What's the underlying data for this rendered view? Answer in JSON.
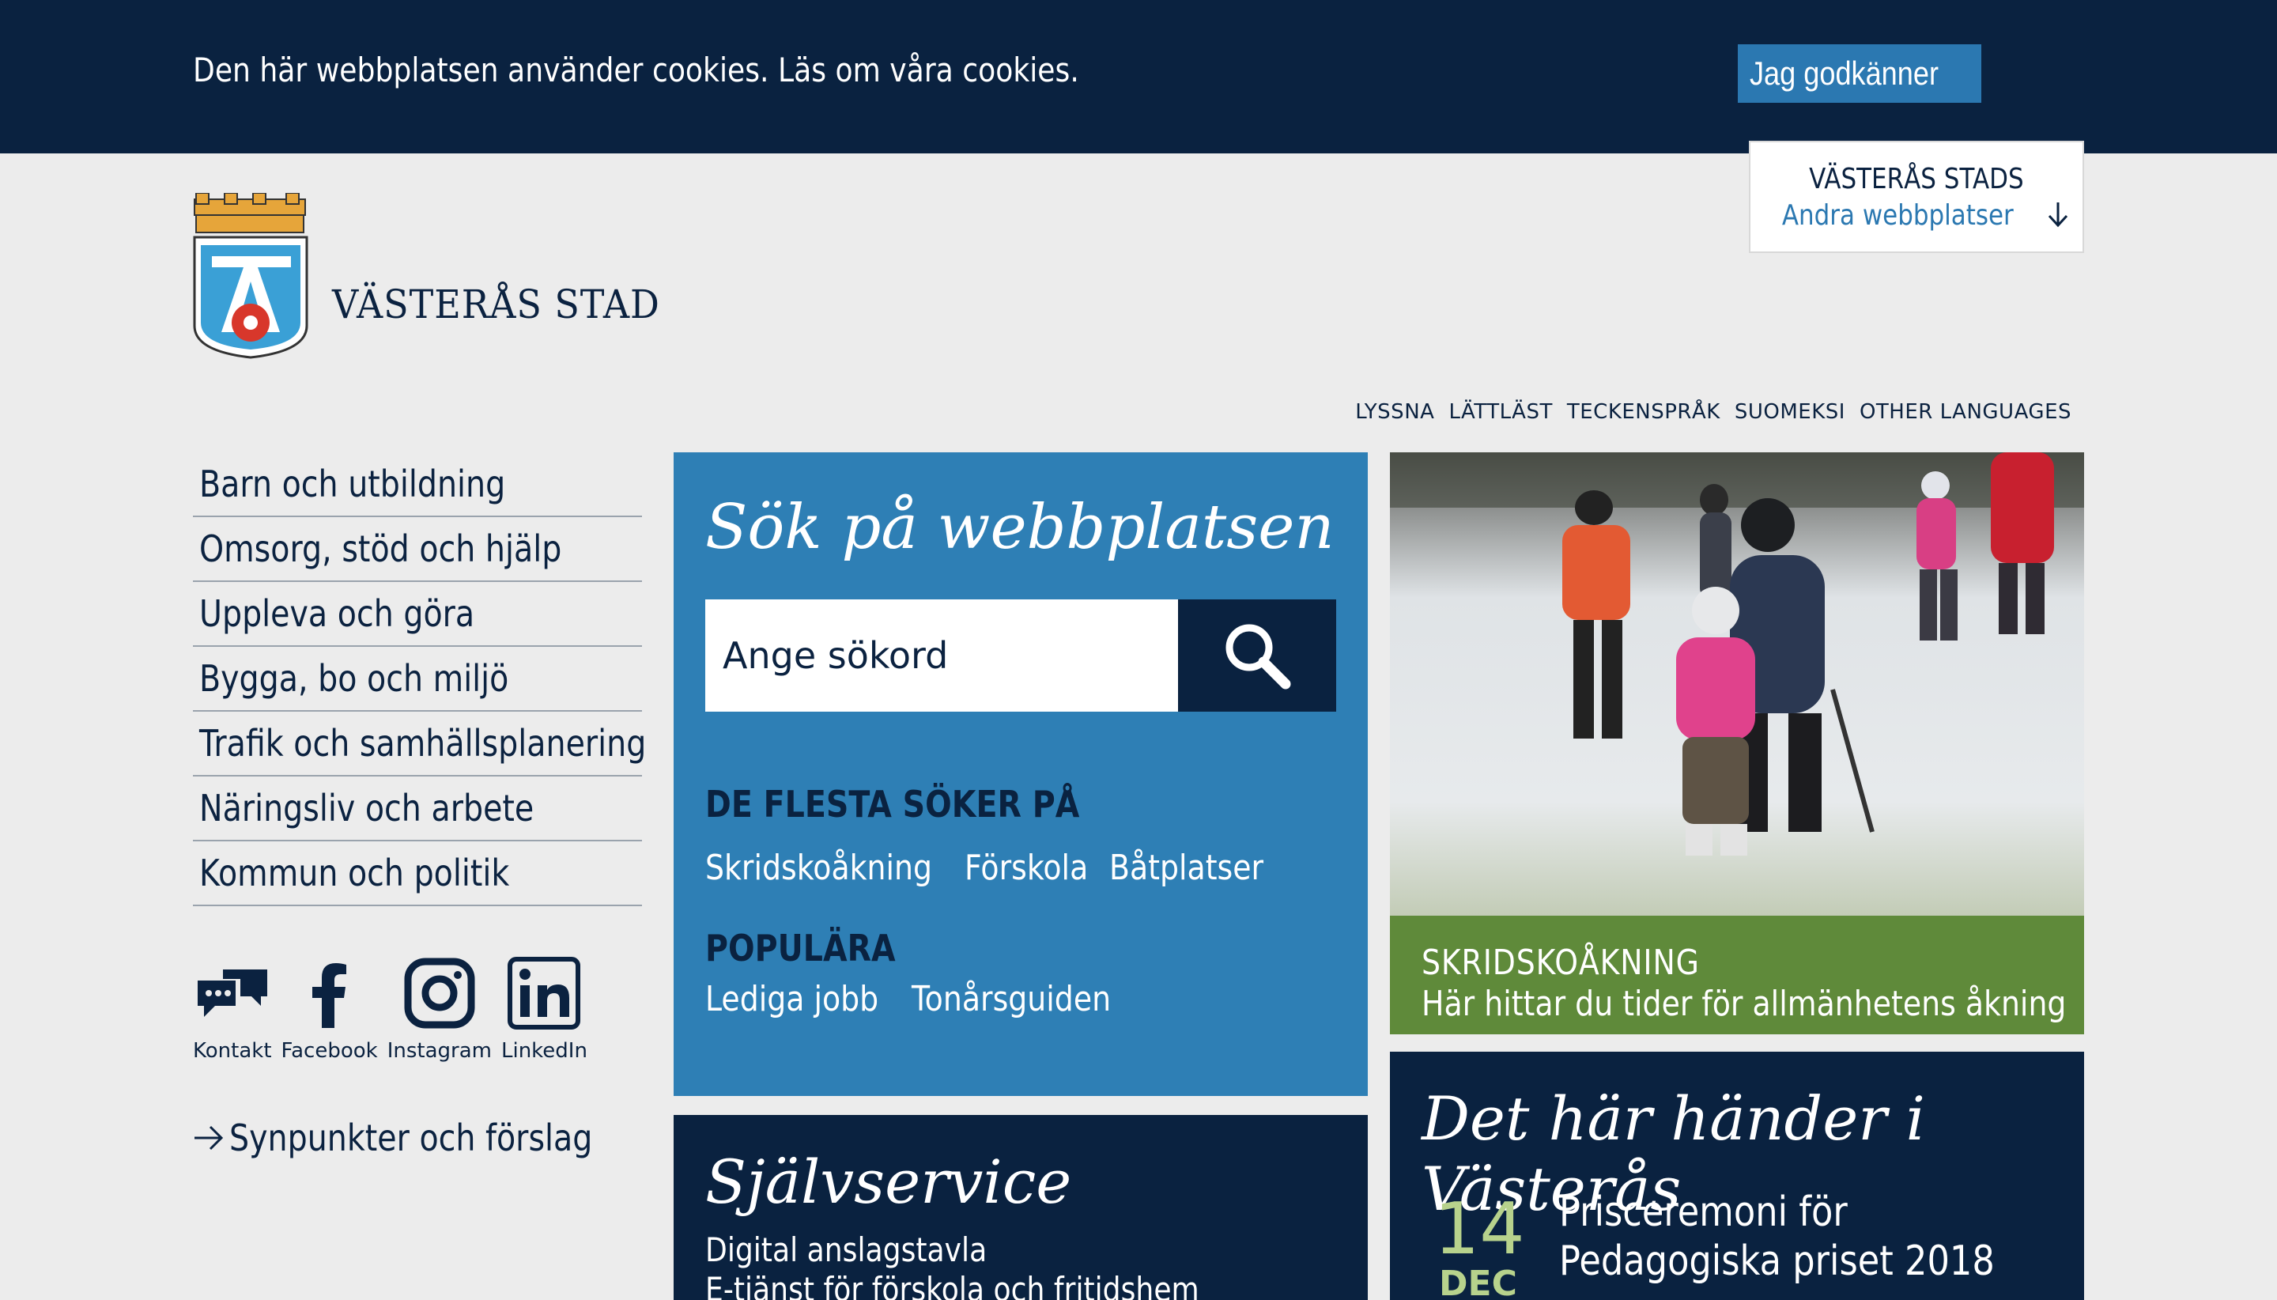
{
  "cookie": {
    "text": "Den här webbplatsen använder cookies. Läs om våra cookies.",
    "accept_label": "Jag godkänner"
  },
  "sites": {
    "title": "VÄSTERÅS STADS",
    "link": "Andra webbplatser"
  },
  "logo": {
    "name": "VÄSTERÅS STAD"
  },
  "lang_links": [
    "LYSSNA",
    "LÄTTLÄST",
    "TECKENSPRÅK",
    "SUOMEKSI",
    "OTHER LANGUAGES"
  ],
  "nav": [
    "Barn och utbildning",
    "Omsorg, stöd och hjälp",
    "Uppleva och göra",
    "Bygga, bo och miljö",
    "Trafik och samhällsplanering",
    "Näringsliv och arbete",
    "Kommun och politik"
  ],
  "social": [
    {
      "label": "Kontakt",
      "icon": "chat-icon"
    },
    {
      "label": "Facebook",
      "icon": "facebook-icon"
    },
    {
      "label": "Instagram",
      "icon": "instagram-icon"
    },
    {
      "label": "LinkedIn",
      "icon": "linkedin-icon"
    }
  ],
  "feedback": "Synpunkter och förslag",
  "search": {
    "heading": "Sök på webbplatsen",
    "placeholder": "Ange sökord",
    "most_searched_heading": "DE FLESTA SÖKER PÅ",
    "most_searched": [
      "Skridskoåkning",
      "Förskola",
      "Båtplatser"
    ],
    "popular_heading": "POPULÄRA",
    "popular": [
      "Lediga jobb",
      "Tonårsguiden"
    ]
  },
  "selfservice": {
    "heading": "Självservice",
    "links": [
      "Digital anslagstavla",
      "E-tjänst för förskola och fritidshem"
    ]
  },
  "feature": {
    "title": "SKRIDSKOÅKNING",
    "subtitle": "Här hittar du tider för allmänhetens åkning"
  },
  "events": {
    "heading": "Det här händer i Västerås",
    "day": "14",
    "month": "DEC",
    "title": "Prisceremoni för Pedagogiska priset 2018"
  },
  "colors": {
    "navy": "#0a2240",
    "blue": "#2e7fb5",
    "green": "#5f8a3a",
    "accent_green": "#b7d28c"
  }
}
